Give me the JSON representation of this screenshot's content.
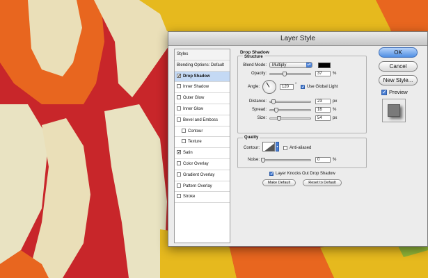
{
  "dialog": {
    "title": "Layer Style",
    "styles_list": [
      {
        "label": "Styles",
        "type": "header"
      },
      {
        "label": "Blending Options: Default",
        "type": "header"
      },
      {
        "label": "Drop Shadow",
        "checked": true,
        "selected": true
      },
      {
        "label": "Inner Shadow",
        "checked": false
      },
      {
        "label": "Outer Glow",
        "checked": false
      },
      {
        "label": "Inner Glow",
        "checked": false
      },
      {
        "label": "Bevel and Emboss",
        "checked": false
      },
      {
        "label": "Contour",
        "checked": false,
        "sub": true
      },
      {
        "label": "Texture",
        "checked": false,
        "sub": true
      },
      {
        "label": "Satin",
        "checked": true
      },
      {
        "label": "Color Overlay",
        "checked": false
      },
      {
        "label": "Gradient Overlay",
        "checked": false
      },
      {
        "label": "Pattern Overlay",
        "checked": false
      },
      {
        "label": "Stroke",
        "checked": false
      }
    ],
    "drop_shadow": {
      "section_title": "Drop Shadow",
      "structure_title": "Structure",
      "blend_mode_label": "Blend Mode:",
      "blend_mode_value": "Multiply",
      "shadow_color": "#000000",
      "opacity_label": "Opacity:",
      "opacity_value": "37",
      "opacity_unit": "%",
      "opacity_level": 0.37,
      "angle_label": "Angle:",
      "angle_value": "120",
      "angle_unit": "°",
      "use_global_light_label": "Use Global Light",
      "use_global_light": true,
      "distance_label": "Distance:",
      "distance_value": "23",
      "distance_unit": "px",
      "distance_level": 0.08,
      "spread_label": "Spread:",
      "spread_value": "16",
      "spread_unit": "%",
      "spread_level": 0.16,
      "size_label": "Size:",
      "size_value": "54",
      "size_unit": "px",
      "size_level": 0.22
    },
    "quality": {
      "title": "Quality",
      "contour_label": "Contour:",
      "anti_aliased_label": "Anti-aliased",
      "anti_aliased": false,
      "noise_label": "Noise:",
      "noise_value": "0",
      "noise_unit": "%",
      "noise_level": 0
    },
    "knockout_label": "Layer Knocks Out Drop Shadow",
    "knockout": true,
    "make_default_label": "Make Default",
    "reset_default_label": "Reset to Default",
    "buttons": {
      "ok": "OK",
      "cancel": "Cancel",
      "new_style": "New Style...",
      "preview": "Preview"
    }
  },
  "colors": {
    "accent": "#4a7fd3",
    "background_red": "#c8262a",
    "background_orange": "#e8661f",
    "background_yellow": "#e6b91e",
    "background_cream": "#e9e3c2"
  }
}
